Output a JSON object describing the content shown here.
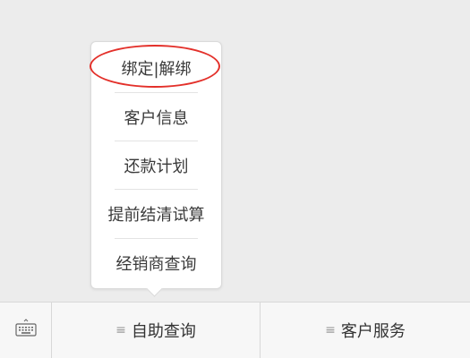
{
  "popup_menu": {
    "items": [
      {
        "label": "绑定|解绑"
      },
      {
        "label": "客户信息"
      },
      {
        "label": "还款计划"
      },
      {
        "label": "提前结清试算"
      },
      {
        "label": "经销商查询"
      }
    ]
  },
  "bottom_bar": {
    "keyboard_icon": "keyboard-icon",
    "tabs": [
      {
        "label": "自助查询",
        "icon": "menu-lines-icon"
      },
      {
        "label": "客户服务",
        "icon": "menu-lines-icon"
      }
    ]
  },
  "colors": {
    "highlight": "#e3302a",
    "background": "#ececec"
  }
}
